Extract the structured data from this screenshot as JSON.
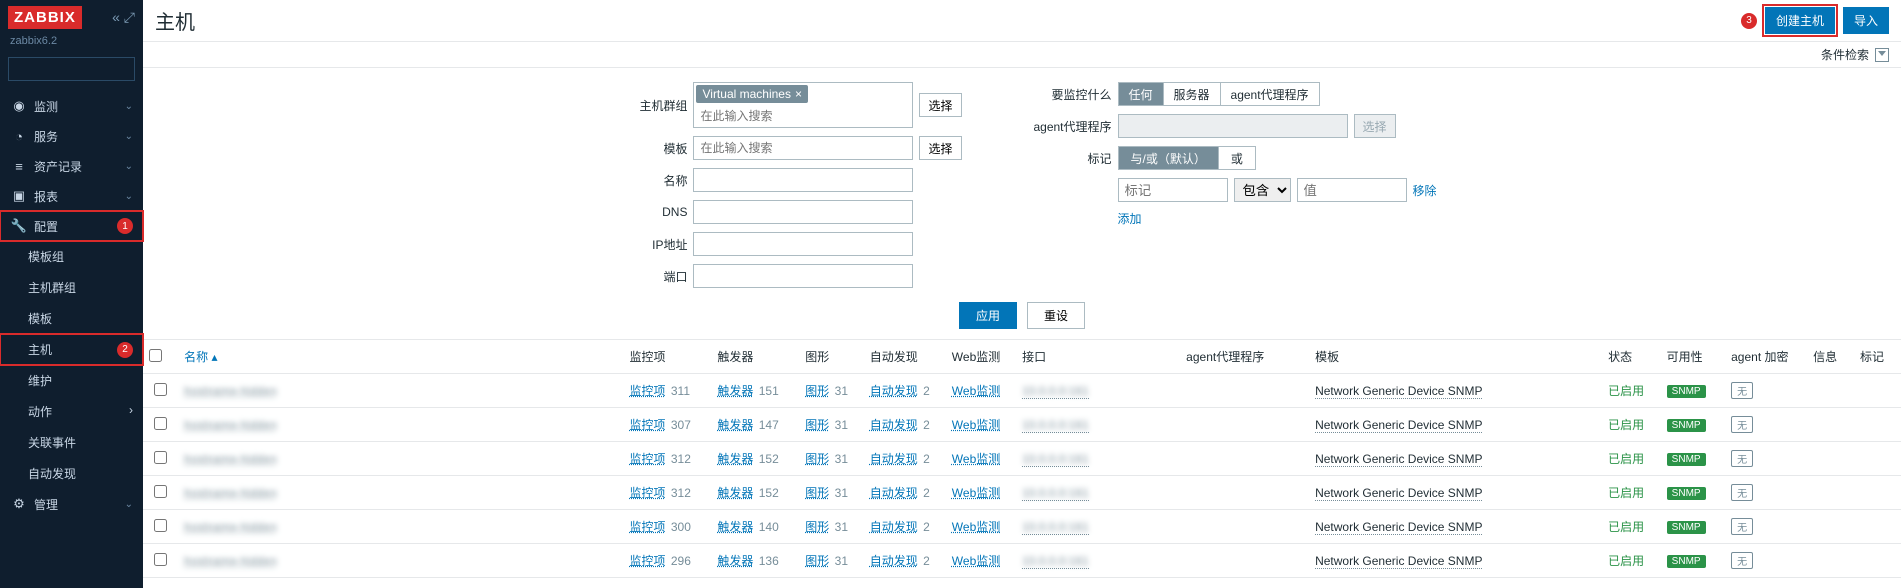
{
  "brand": "ZABBIX",
  "subtitle": "zabbix6.2",
  "search_placeholder": "",
  "nav": [
    {
      "icon": "◉",
      "label": "监测",
      "chev": "⌄"
    },
    {
      "icon": "◔",
      "label": "服务",
      "chev": "⌄"
    },
    {
      "icon": "≡",
      "label": "资产记录",
      "chev": "⌄"
    },
    {
      "icon": "▣",
      "label": "报表",
      "chev": "⌄"
    },
    {
      "icon": "🔧",
      "label": "配置",
      "chev": "⌃",
      "badge": "1",
      "hl": true,
      "open": true
    },
    {
      "icon": "⚙",
      "label": "管理",
      "chev": "⌄"
    }
  ],
  "nav_config_sub": [
    {
      "label": "模板组"
    },
    {
      "label": "主机群组"
    },
    {
      "label": "模板"
    },
    {
      "label": "主机",
      "hl": true,
      "badge": "2"
    },
    {
      "label": "维护"
    },
    {
      "label": "动作",
      "chev": "›"
    },
    {
      "label": "关联事件"
    },
    {
      "label": "自动发现"
    }
  ],
  "page_title": "主机",
  "btn_create": "创建主机",
  "btn_import": "导入",
  "circ3": "3",
  "filter_toggle": "条件检索",
  "filters": {
    "hostgroup_label": "主机群组",
    "hostgroup_chip": "Virtual machines",
    "hostgroup_placeholder": "在此输入搜索",
    "select_btn": "选择",
    "template_label": "模板",
    "template_placeholder": "在此输入搜索",
    "name_label": "名称",
    "dns_label": "DNS",
    "ip_label": "IP地址",
    "port_label": "端口",
    "monitor_label": "要监控什么",
    "seg_any": "任何",
    "seg_server": "服务器",
    "seg_agent": "agent代理程序",
    "proxy_label": "agent代理程序",
    "proxy_select": "选择",
    "tags_label": "标记",
    "seg_andor": "与/或（默认）",
    "seg_or": "或",
    "tag_ph": "标记",
    "op_contain": "包含",
    "val_ph": "值",
    "remove": "移除",
    "add": "添加"
  },
  "btn_apply": "应用",
  "btn_reset": "重设",
  "columns": {
    "name": "名称 ▴",
    "items": "监控项",
    "triggers": "触发器",
    "graphs": "图形",
    "discovery": "自动发现",
    "web": "Web监测",
    "iface": "接口",
    "proxy": "agent代理程序",
    "templates": "模板",
    "status": "状态",
    "avail": "可用性",
    "enc": "agent 加密",
    "info": "信息",
    "tags": "标记"
  },
  "rows": [
    {
      "items": "311",
      "triggers": "151",
      "graphs": "31",
      "discovery": "2"
    },
    {
      "items": "307",
      "triggers": "147",
      "graphs": "31",
      "discovery": "2"
    },
    {
      "items": "312",
      "triggers": "152",
      "graphs": "31",
      "discovery": "2"
    },
    {
      "items": "312",
      "triggers": "152",
      "graphs": "31",
      "discovery": "2"
    },
    {
      "items": "300",
      "triggers": "140",
      "graphs": "31",
      "discovery": "2"
    },
    {
      "items": "296",
      "triggers": "136",
      "graphs": "31",
      "discovery": "2"
    }
  ],
  "row_labels": {
    "items": "监控项",
    "triggers": "触发器",
    "graphs": "图形",
    "discovery": "自动发现",
    "web": "Web监测",
    "template": "Network Generic Device SNMP",
    "status": "已启用",
    "snmp": "SNMP",
    "enc_no": "无"
  }
}
